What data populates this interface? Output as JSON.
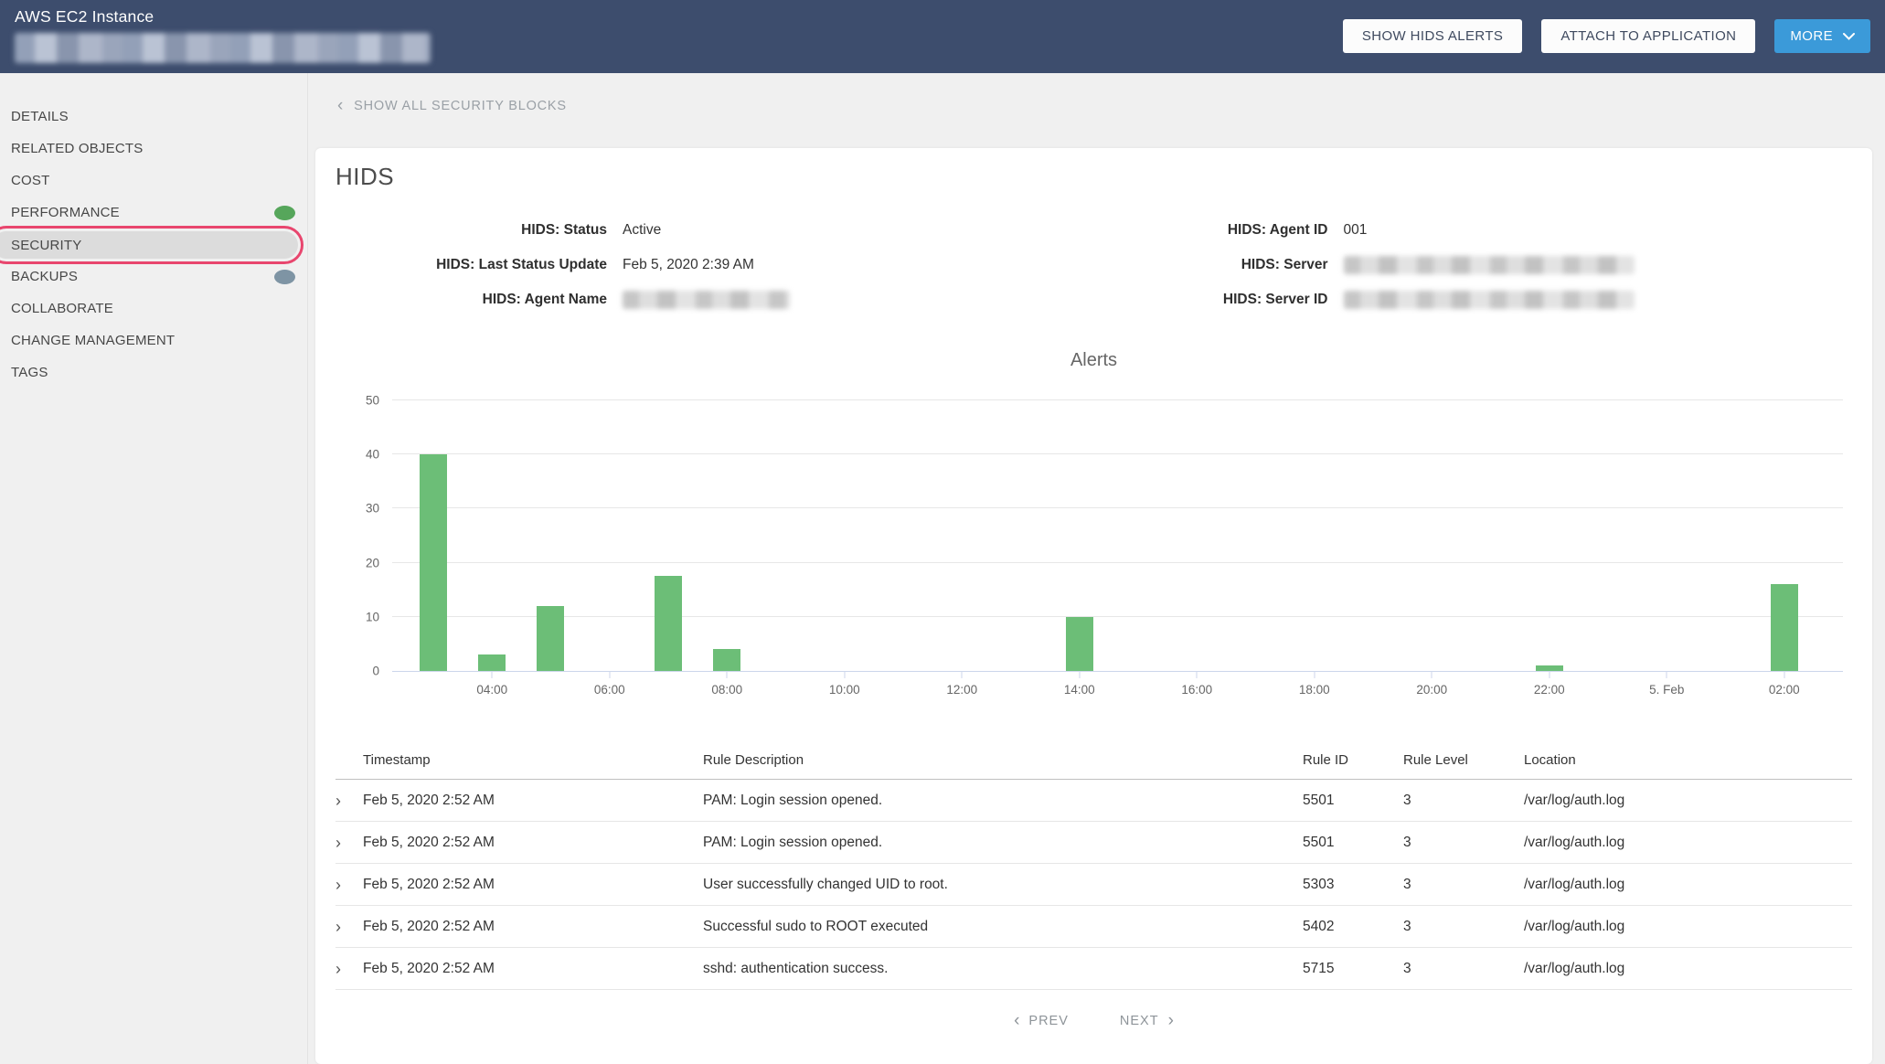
{
  "header": {
    "title": "AWS EC2 Instance",
    "subtitle_redacted": true,
    "buttons": {
      "show_hids_alerts": "SHOW HIDS ALERTS",
      "attach_to_application": "ATTACH TO APPLICATION",
      "more": "MORE"
    }
  },
  "sidebar": {
    "items": [
      {
        "label": "DETAILS"
      },
      {
        "label": "RELATED OBJECTS"
      },
      {
        "label": "COST"
      },
      {
        "label": "PERFORMANCE",
        "dot_color": "#56a65b"
      },
      {
        "label": "SECURITY",
        "selected": true,
        "highlight_ring_color": "#e8466e"
      },
      {
        "label": "BACKUPS",
        "dot_color": "#7e94a4"
      },
      {
        "label": "COLLABORATE"
      },
      {
        "label": "CHANGE MANAGEMENT"
      },
      {
        "label": "TAGS"
      }
    ]
  },
  "toolbar": {
    "back_link": "SHOW ALL SECURITY BLOCKS"
  },
  "panel": {
    "title": "HIDS",
    "fields_left": [
      {
        "label": "HIDS: Status",
        "value": "Active"
      },
      {
        "label": "HIDS: Last Status Update",
        "value": "Feb 5, 2020 2:39 AM"
      },
      {
        "label": "HIDS: Agent Name",
        "redacted": true
      }
    ],
    "fields_right": [
      {
        "label": "HIDS: Agent ID",
        "value": "001"
      },
      {
        "label": "HIDS: Server",
        "redacted": true
      },
      {
        "label": "HIDS: Server ID",
        "redacted": true
      }
    ]
  },
  "chart_data": {
    "type": "bar",
    "title": "Alerts",
    "bar_color": "#6cbe77",
    "ylim": [
      0,
      50
    ],
    "yticks": [
      0,
      10,
      20,
      30,
      40,
      50
    ],
    "grid": true,
    "legend": false,
    "x_axis_hours_range": [
      2.3,
      27.0
    ],
    "xticks": [
      {
        "hour": 4,
        "label": "04:00"
      },
      {
        "hour": 6,
        "label": "06:00"
      },
      {
        "hour": 8,
        "label": "08:00"
      },
      {
        "hour": 10,
        "label": "10:00"
      },
      {
        "hour": 12,
        "label": "12:00"
      },
      {
        "hour": 14,
        "label": "14:00"
      },
      {
        "hour": 16,
        "label": "16:00"
      },
      {
        "hour": 18,
        "label": "18:00"
      },
      {
        "hour": 20,
        "label": "20:00"
      },
      {
        "hour": 22,
        "label": "22:00"
      },
      {
        "hour": 24,
        "label": "5. Feb"
      },
      {
        "hour": 26,
        "label": "02:00"
      }
    ],
    "points": [
      {
        "hour": 3,
        "value": 40
      },
      {
        "hour": 4,
        "value": 3
      },
      {
        "hour": 5,
        "value": 12
      },
      {
        "hour": 7,
        "value": 17.5
      },
      {
        "hour": 8,
        "value": 4
      },
      {
        "hour": 14,
        "value": 10
      },
      {
        "hour": 22,
        "value": 1
      },
      {
        "hour": 26,
        "value": 16
      }
    ]
  },
  "table": {
    "columns": [
      "Timestamp",
      "Rule Description",
      "Rule ID",
      "Rule Level",
      "Location"
    ],
    "rows": [
      {
        "timestamp": "Feb 5, 2020 2:52 AM",
        "rule_description": "PAM: Login session opened.",
        "rule_id": "5501",
        "rule_level": "3",
        "location": "/var/log/auth.log"
      },
      {
        "timestamp": "Feb 5, 2020 2:52 AM",
        "rule_description": "PAM: Login session opened.",
        "rule_id": "5501",
        "rule_level": "3",
        "location": "/var/log/auth.log"
      },
      {
        "timestamp": "Feb 5, 2020 2:52 AM",
        "rule_description": "User successfully changed UID to root.",
        "rule_id": "5303",
        "rule_level": "3",
        "location": "/var/log/auth.log"
      },
      {
        "timestamp": "Feb 5, 2020 2:52 AM",
        "rule_description": "Successful sudo to ROOT executed",
        "rule_id": "5402",
        "rule_level": "3",
        "location": "/var/log/auth.log"
      },
      {
        "timestamp": "Feb 5, 2020 2:52 AM",
        "rule_description": "sshd: authentication success.",
        "rule_id": "5715",
        "rule_level": "3",
        "location": "/var/log/auth.log"
      }
    ],
    "pagination": {
      "prev": "PREV",
      "next": "NEXT"
    }
  },
  "colors": {
    "topbar_bg": "#3d4d6d",
    "accent_blue": "#3b9ad9",
    "page_bg": "#f0f0f0",
    "bar_green": "#6cbe77",
    "axis_line": "#ccd6eb",
    "selection_ring": "#e8466e"
  }
}
